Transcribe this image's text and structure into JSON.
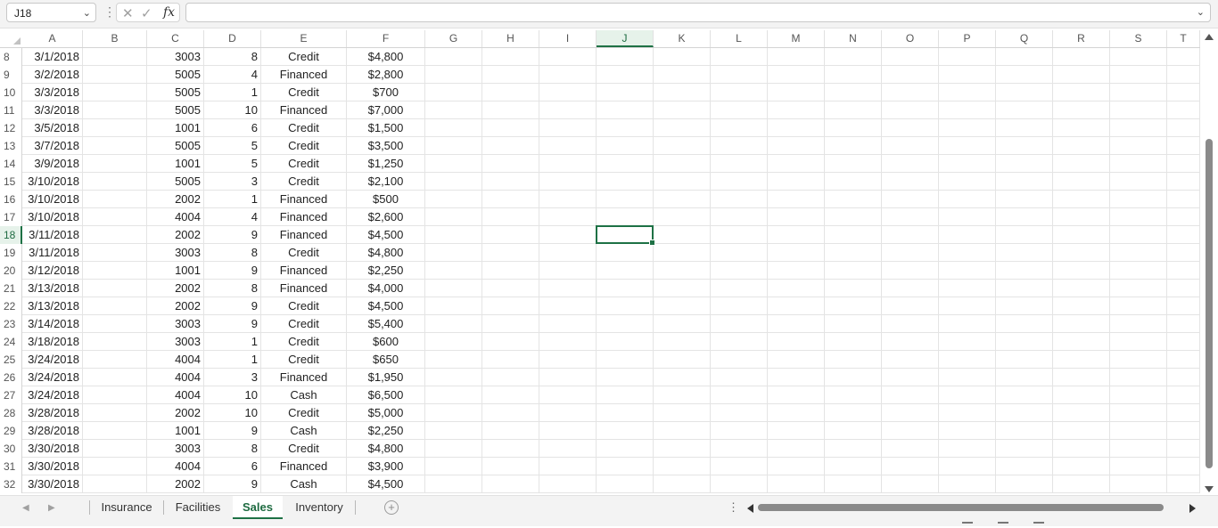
{
  "formula_bar": {
    "name_box": "J18",
    "formula": ""
  },
  "columns": [
    "A",
    "B",
    "C",
    "D",
    "E",
    "F",
    "G",
    "H",
    "I",
    "J",
    "K",
    "L",
    "M",
    "N",
    "O",
    "P",
    "Q",
    "R",
    "S",
    "T"
  ],
  "active_column": "J",
  "active_row": "18",
  "rows": [
    {
      "num": "8",
      "date": "3/1/2018",
      "code": "3003",
      "qty": "8",
      "payment": "Credit",
      "amount": "$4,800"
    },
    {
      "num": "9",
      "date": "3/2/2018",
      "code": "5005",
      "qty": "4",
      "payment": "Financed",
      "amount": "$2,800"
    },
    {
      "num": "10",
      "date": "3/3/2018",
      "code": "5005",
      "qty": "1",
      "payment": "Credit",
      "amount": "$700"
    },
    {
      "num": "11",
      "date": "3/3/2018",
      "code": "5005",
      "qty": "10",
      "payment": "Financed",
      "amount": "$7,000"
    },
    {
      "num": "12",
      "date": "3/5/2018",
      "code": "1001",
      "qty": "6",
      "payment": "Credit",
      "amount": "$1,500"
    },
    {
      "num": "13",
      "date": "3/7/2018",
      "code": "5005",
      "qty": "5",
      "payment": "Credit",
      "amount": "$3,500"
    },
    {
      "num": "14",
      "date": "3/9/2018",
      "code": "1001",
      "qty": "5",
      "payment": "Credit",
      "amount": "$1,250"
    },
    {
      "num": "15",
      "date": "3/10/2018",
      "code": "5005",
      "qty": "3",
      "payment": "Credit",
      "amount": "$2,100"
    },
    {
      "num": "16",
      "date": "3/10/2018",
      "code": "2002",
      "qty": "1",
      "payment": "Financed",
      "amount": "$500"
    },
    {
      "num": "17",
      "date": "3/10/2018",
      "code": "4004",
      "qty": "4",
      "payment": "Financed",
      "amount": "$2,600"
    },
    {
      "num": "18",
      "date": "3/11/2018",
      "code": "2002",
      "qty": "9",
      "payment": "Financed",
      "amount": "$4,500"
    },
    {
      "num": "19",
      "date": "3/11/2018",
      "code": "3003",
      "qty": "8",
      "payment": "Credit",
      "amount": "$4,800"
    },
    {
      "num": "20",
      "date": "3/12/2018",
      "code": "1001",
      "qty": "9",
      "payment": "Financed",
      "amount": "$2,250"
    },
    {
      "num": "21",
      "date": "3/13/2018",
      "code": "2002",
      "qty": "8",
      "payment": "Financed",
      "amount": "$4,000"
    },
    {
      "num": "22",
      "date": "3/13/2018",
      "code": "2002",
      "qty": "9",
      "payment": "Credit",
      "amount": "$4,500"
    },
    {
      "num": "23",
      "date": "3/14/2018",
      "code": "3003",
      "qty": "9",
      "payment": "Credit",
      "amount": "$5,400"
    },
    {
      "num": "24",
      "date": "3/18/2018",
      "code": "3003",
      "qty": "1",
      "payment": "Credit",
      "amount": "$600"
    },
    {
      "num": "25",
      "date": "3/24/2018",
      "code": "4004",
      "qty": "1",
      "payment": "Credit",
      "amount": "$650"
    },
    {
      "num": "26",
      "date": "3/24/2018",
      "code": "4004",
      "qty": "3",
      "payment": "Financed",
      "amount": "$1,950"
    },
    {
      "num": "27",
      "date": "3/24/2018",
      "code": "4004",
      "qty": "10",
      "payment": "Cash",
      "amount": "$6,500"
    },
    {
      "num": "28",
      "date": "3/28/2018",
      "code": "2002",
      "qty": "10",
      "payment": "Credit",
      "amount": "$5,000"
    },
    {
      "num": "29",
      "date": "3/28/2018",
      "code": "1001",
      "qty": "9",
      "payment": "Cash",
      "amount": "$2,250"
    },
    {
      "num": "30",
      "date": "3/30/2018",
      "code": "3003",
      "qty": "8",
      "payment": "Credit",
      "amount": "$4,800"
    },
    {
      "num": "31",
      "date": "3/30/2018",
      "code": "4004",
      "qty": "6",
      "payment": "Financed",
      "amount": "$3,900"
    },
    {
      "num": "32",
      "date": "3/30/2018",
      "code": "2002",
      "qty": "9",
      "payment": "Cash",
      "amount": "$4,500"
    }
  ],
  "sheets": [
    {
      "label": "Insurance",
      "active": false
    },
    {
      "label": "Facilities",
      "active": false
    },
    {
      "label": "Sales",
      "active": true
    },
    {
      "label": "Inventory",
      "active": false
    }
  ],
  "colors": {
    "accent": "#1e7145",
    "grid_line": "#e4e4e4",
    "chrome": "#f3f3f3"
  }
}
